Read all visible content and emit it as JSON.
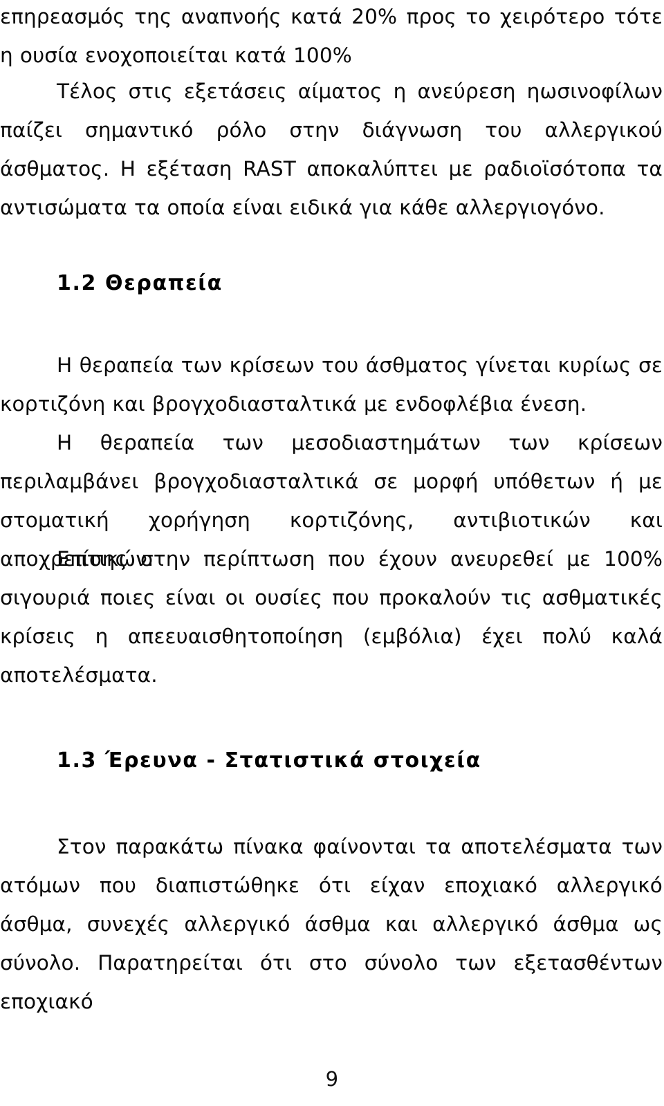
{
  "document": {
    "language": "el",
    "page_number": "9",
    "background_color": "#ffffff",
    "text_color": "#000000"
  },
  "blocks": {
    "paragraph_1": {
      "text": "επηρεασμός της αναπνοής κατά 20% προς το χειρότερο τότε η ουσία ενοχοποιείται κατά 100%"
    },
    "paragraph_2": {
      "text": "Τέλος στις εξετάσεις αίματος η ανεύρεση ηωσινοφίλων παίζει σημαντικό ρόλο στην διάγνωση του αλλεργικού άσθματος. Η εξέταση RAST αποκαλύπτει με ραδιοϊσότοπα τα αντισώματα τα οποία είναι ειδικά για κάθε αλλεργιογόνο."
    },
    "heading_1_2": {
      "number": "1.2",
      "title": "Θεραπεία",
      "text": "1.2 Θεραπεία"
    },
    "paragraph_3": {
      "text": "Η θεραπεία των κρίσεων του άσθματος γίνεται κυρίως σε κορτιζόνη και βρογχοδιασταλτικά με ενδοφλέβια ένεση."
    },
    "paragraph_4": {
      "text": "Η θεραπεία των μεσοδιαστημάτων των κρίσεων περιλαμβάνει βρογχοδιασταλτικά σε μορφή υπόθετων ή με στοματική χορήγηση κορτιζόνης, αντιβιοτικών και αποχρεπτικών."
    },
    "paragraph_5": {
      "text": "Επίσης στην περίπτωση που έχουν ανευρεθεί με 100% σιγουριά ποιες είναι οι ουσίες που προκαλούν τις ασθματικές κρίσεις η απεευαισθητοποίηση (εμβόλια) έχει πολύ καλά αποτελέσματα."
    },
    "heading_1_3": {
      "number": "1.3",
      "title": "Έρευνα - Στατιστικά στοιχεία",
      "text": "1.3 Έρευνα - Στατιστικά στοιχεία"
    },
    "paragraph_6": {
      "text": "Στον παρακάτω πίνακα φαίνονται τα αποτελέσματα των ατόμων που διαπιστώθηκε ότι είχαν εποχιακό αλλεργικό άσθμα, συνεχές αλλεργικό άσθμα και αλλεργικό άσθμα ως σύνολο. Παρατηρείται ότι στο σύνολο των εξετασθέντων εποχιακό"
    }
  },
  "footer": {
    "page_number": "9"
  }
}
